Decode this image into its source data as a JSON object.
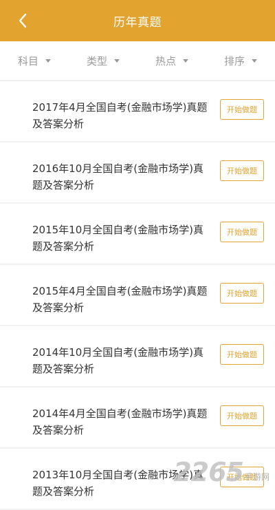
{
  "header": {
    "title": "历年真题"
  },
  "filters": [
    {
      "label": "科目"
    },
    {
      "label": "类型"
    },
    {
      "label": "热点"
    },
    {
      "label": "排序"
    }
  ],
  "items": [
    {
      "title": "2017年4月全国自考(金融市场学)真题及答案分析",
      "action": "开始做题"
    },
    {
      "title": "2016年10月全国自考(金融市场学)真题及答案分析",
      "action": "开始做题"
    },
    {
      "title": "2015年10月全国自考(金融市场学)真题及答案分析",
      "action": "开始做题"
    },
    {
      "title": "2015年4月全国自考(金融市场学)真题及答案分析",
      "action": "开始做题"
    },
    {
      "title": "2014年10月全国自考(金融市场学)真题及答案分析",
      "action": "开始做题"
    },
    {
      "title": "2014年4月全国自考(金融市场学)真题及答案分析",
      "action": "开始做题"
    },
    {
      "title": "2013年10月全国自考(金融市场学)真题及答案分析",
      "action": "开始做题"
    }
  ],
  "watermark": {
    "number": "2265",
    "text": "手游网"
  },
  "colors": {
    "accent": "#e2a42f",
    "text": "#333333",
    "muted": "#9a9a9a"
  }
}
